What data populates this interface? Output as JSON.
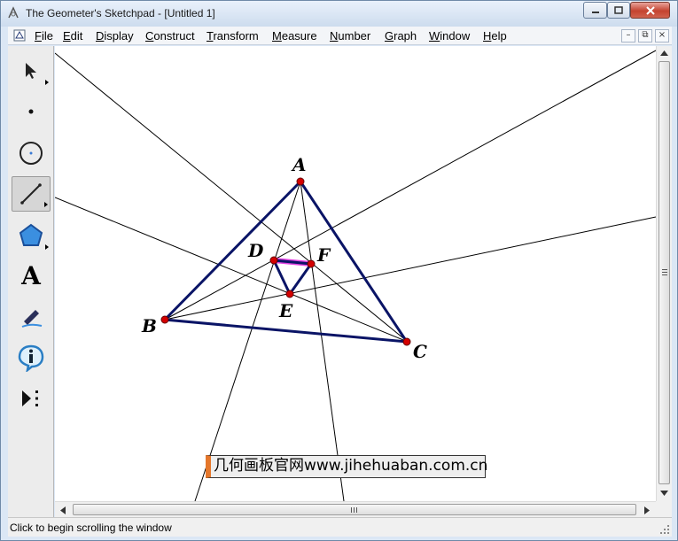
{
  "window": {
    "title": "The Geometer's Sketchpad - [Untitled 1]"
  },
  "menu": {
    "items": [
      "File",
      "Edit",
      "Display",
      "Construct",
      "Transform",
      "Measure",
      "Number",
      "Graph",
      "Window",
      "Help"
    ],
    "mdi_minimize": "–",
    "mdi_restore": "⧉",
    "mdi_close": "×"
  },
  "toolbox": {
    "tools": [
      "arrow-selection",
      "point",
      "compass",
      "straightedge",
      "polygon",
      "text",
      "marker",
      "information",
      "custom-tools"
    ],
    "selected": "straightedge",
    "text_tool_glyph": "A"
  },
  "sketch": {
    "point_labels": {
      "A": "A",
      "B": "B",
      "C": "C",
      "D": "D",
      "E": "E",
      "F": "F"
    },
    "colors": {
      "triangle": "#0a1466",
      "lines": "#000000",
      "points": "#d40000",
      "highlight": "#e040e0"
    }
  },
  "watermark": {
    "text": "几何画板官网www.jihehuaban.com.cn",
    "accent": "#e5772b"
  },
  "statusbar": {
    "text": "Click to begin scrolling the window"
  }
}
